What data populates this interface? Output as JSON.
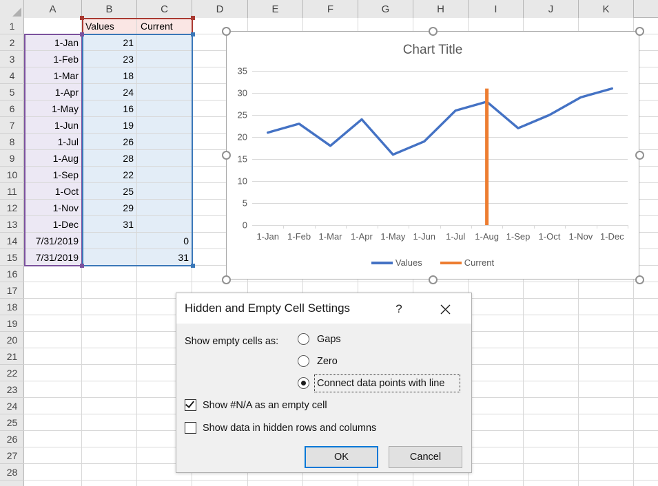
{
  "spreadsheet": {
    "column_headers": [
      "A",
      "B",
      "C",
      "D",
      "E",
      "F",
      "G",
      "H",
      "I",
      "J",
      "K"
    ],
    "row_numbers": [
      "1",
      "2",
      "3",
      "4",
      "5",
      "6",
      "7",
      "8",
      "9",
      "10",
      "11",
      "12",
      "13",
      "14",
      "15",
      "16",
      "17",
      "18",
      "19",
      "20",
      "21",
      "22",
      "23",
      "24",
      "25",
      "26",
      "27",
      "28"
    ],
    "header_row": {
      "b": "Values",
      "c": "Current"
    },
    "rows": [
      {
        "row": "2",
        "a": "1-Jan",
        "b": "21",
        "c": ""
      },
      {
        "row": "3",
        "a": "1-Feb",
        "b": "23",
        "c": ""
      },
      {
        "row": "4",
        "a": "1-Mar",
        "b": "18",
        "c": ""
      },
      {
        "row": "5",
        "a": "1-Apr",
        "b": "24",
        "c": ""
      },
      {
        "row": "6",
        "a": "1-May",
        "b": "16",
        "c": ""
      },
      {
        "row": "7",
        "a": "1-Jun",
        "b": "19",
        "c": ""
      },
      {
        "row": "8",
        "a": "1-Jul",
        "b": "26",
        "c": ""
      },
      {
        "row": "9",
        "a": "1-Aug",
        "b": "28",
        "c": ""
      },
      {
        "row": "10",
        "a": "1-Sep",
        "b": "22",
        "c": ""
      },
      {
        "row": "11",
        "a": "1-Oct",
        "b": "25",
        "c": ""
      },
      {
        "row": "12",
        "a": "1-Nov",
        "b": "29",
        "c": ""
      },
      {
        "row": "13",
        "a": "1-Dec",
        "b": "31",
        "c": ""
      },
      {
        "row": "14",
        "a": "7/31/2019",
        "b": "",
        "c": "0"
      },
      {
        "row": "15",
        "a": "7/31/2019",
        "b": "",
        "c": "31"
      }
    ],
    "selection_colors": {
      "values_range": "#7b519d",
      "current_range": "#3a77b8",
      "header_range": "#a93a32"
    }
  },
  "chart_data": {
    "type": "line",
    "title": "Chart Title",
    "xlabel": "",
    "ylabel": "",
    "categories": [
      "1-Jan",
      "1-Feb",
      "1-Mar",
      "1-Apr",
      "1-May",
      "1-Jun",
      "1-Jul",
      "1-Aug",
      "1-Sep",
      "1-Oct",
      "1-Nov",
      "1-Dec"
    ],
    "yticks": [
      0,
      5,
      10,
      15,
      20,
      25,
      30,
      35
    ],
    "ylim": [
      0,
      35
    ],
    "grid": true,
    "legend_position": "bottom",
    "series": [
      {
        "name": "Values",
        "color": "#4472c4",
        "values": [
          21,
          23,
          18,
          24,
          16,
          19,
          26,
          28,
          22,
          25,
          29,
          31
        ]
      },
      {
        "name": "Current",
        "color": "#ed7d31",
        "values": [
          null,
          null,
          null,
          null,
          null,
          null,
          null,
          31,
          null,
          null,
          null,
          null
        ],
        "note": "vertical marker line at 1-Aug from 0 to 31"
      }
    ]
  },
  "dialog": {
    "title": "Hidden and Empty Cell Settings",
    "help_icon": "?",
    "close_icon": "✕",
    "group_label": "Show empty cells as:",
    "radios": [
      {
        "label": "Gaps",
        "selected": false
      },
      {
        "label": "Zero",
        "selected": false
      },
      {
        "label": "Connect data points with line",
        "selected": true
      }
    ],
    "checkboxes": [
      {
        "label": "Show #N/A as an empty cell",
        "checked": true
      },
      {
        "label": "Show data in hidden rows and columns",
        "checked": false
      }
    ],
    "buttons": {
      "ok": "OK",
      "cancel": "Cancel"
    },
    "accent": "#0078d7"
  }
}
